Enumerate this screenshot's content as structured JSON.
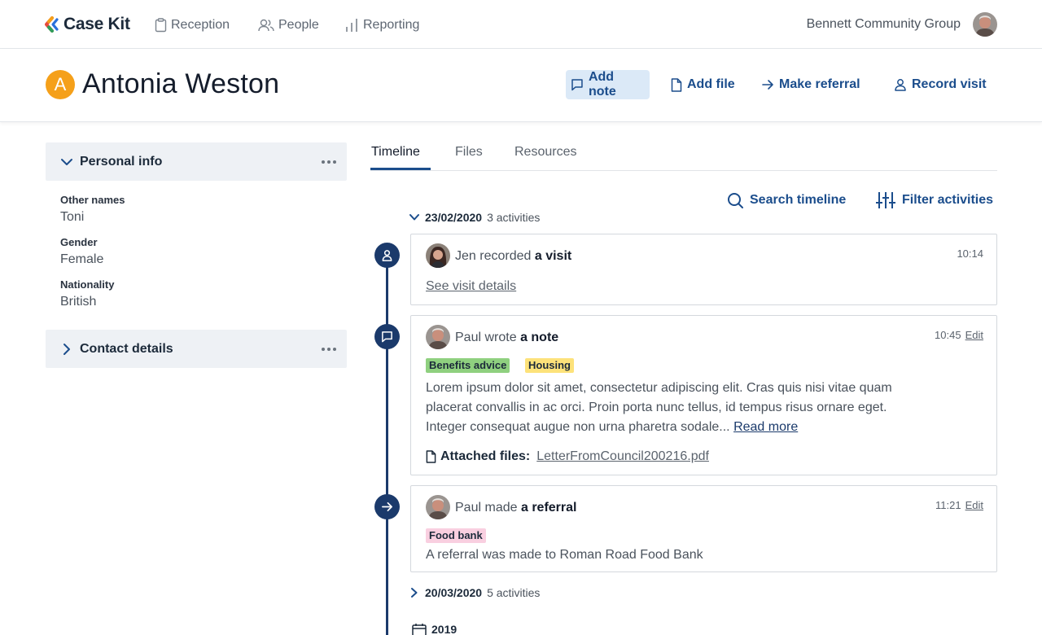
{
  "brand": {
    "name": "Case Kit"
  },
  "nav": {
    "items": [
      {
        "label": "Reception",
        "icon": "clipboard-icon"
      },
      {
        "label": "People",
        "icon": "people-icon"
      },
      {
        "label": "Reporting",
        "icon": "bar-chart-icon"
      }
    ],
    "org_name": "Bennett Community Group"
  },
  "person": {
    "initial": "A",
    "name": "Antonia Weston"
  },
  "actions": {
    "add_note": "Add note",
    "add_file": "Add file",
    "make_referral": "Make referral",
    "record_visit": "Record visit"
  },
  "sidebar": {
    "personal_info": {
      "title": "Personal info",
      "fields": [
        {
          "label": "Other names",
          "value": "Toni"
        },
        {
          "label": "Gender",
          "value": "Female"
        },
        {
          "label": "Nationality",
          "value": "British"
        }
      ]
    },
    "contact_details": {
      "title": "Contact details"
    }
  },
  "tabs": [
    "Timeline",
    "Files",
    "Resources"
  ],
  "tools": {
    "search": "Search timeline",
    "filter": "Filter activities"
  },
  "groups": [
    {
      "date": "23/02/2020",
      "count": "3 activities"
    },
    {
      "date": "20/03/2020",
      "count": "5 activities"
    },
    {
      "date": "2019"
    }
  ],
  "activities": [
    {
      "author": "Jen",
      "verb": "recorded",
      "object": "a visit",
      "time": "10:14",
      "link": "See visit details"
    },
    {
      "author": "Paul",
      "verb": "wrote",
      "object": "a note",
      "time": "10:45",
      "edit": "Edit",
      "tags": [
        {
          "label": "Benefits advice",
          "color": "#8fd07f"
        },
        {
          "label": "Housing",
          "color": "#fde27a"
        }
      ],
      "body_lines": [
        "Lorem ipsum dolor sit amet, consectetur adipiscing elit. Cras quis nisi vitae quam",
        "placerat convallis in ac orci. Proin porta nunc tellus, id tempus risus ornare eget.",
        "Integer consequat augue non urna pharetra sodale..."
      ],
      "read_more": "Read more",
      "attached_label": "Attached files:",
      "attached_file": "LetterFromCouncil200216.pdf"
    },
    {
      "author": "Paul",
      "verb": "made",
      "object": "a referral",
      "time": "11:21",
      "edit": "Edit",
      "tags": [
        {
          "label": "Food bank",
          "color": "#f9cfe0"
        }
      ],
      "body": "A referral was made to Roman Road Food Bank"
    }
  ],
  "colors": {
    "primary": "#1b4d8c",
    "timeline": "#1b3a6b",
    "badge": "#f5a01a",
    "active_button_bg": "#dbe9f7"
  }
}
